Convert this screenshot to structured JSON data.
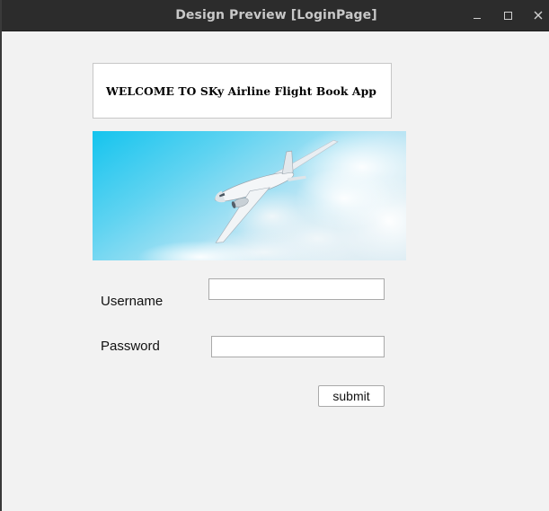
{
  "window": {
    "title": "Design Preview [LoginPage]"
  },
  "welcome": {
    "text": "WELCOME TO SKy Airline Flight Book App"
  },
  "banner": {
    "description_icon": "airplane-in-clouds-image"
  },
  "form": {
    "username_label": "Username",
    "username_value": "",
    "password_label": "Password",
    "password_value": "",
    "submit_label": "submit"
  },
  "colors": {
    "background": "#f2f2f2",
    "titlebar": "#2c2c2c",
    "sky_top": "#1ec8ee",
    "sky_light": "#bfe6f5"
  }
}
